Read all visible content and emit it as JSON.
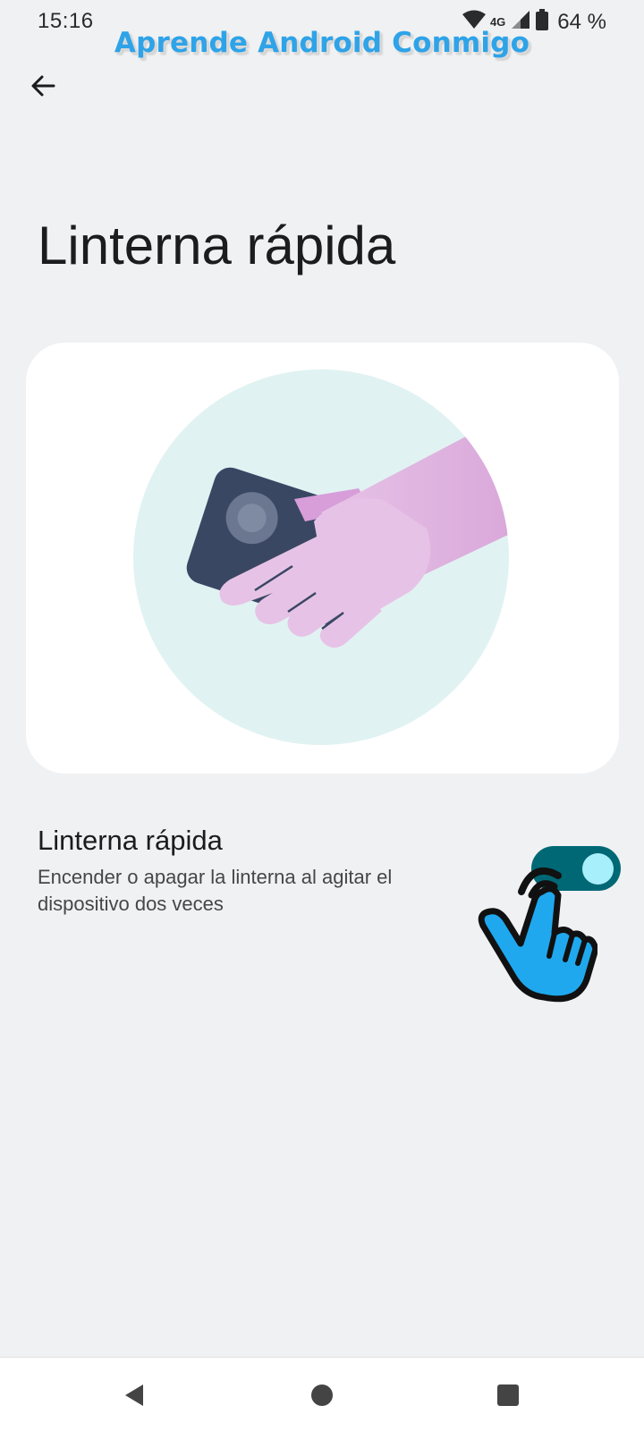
{
  "status_bar": {
    "time": "15:16",
    "network": "4G",
    "battery": "64 %",
    "icons": [
      "wifi-icon",
      "cell-signal-icon",
      "battery-icon"
    ]
  },
  "watermark": {
    "text": "Aprende Android Conmigo",
    "color": "#2ea3e8"
  },
  "header": {
    "back_icon": "arrow-left-icon"
  },
  "page": {
    "title": "Linterna rápida"
  },
  "setting": {
    "title": "Linterna rápida",
    "summary": "Encender o apagar la linterna al agitar el dispositivo dos veces",
    "toggle_on": true,
    "toggle_color": "#006875",
    "thumb_color": "#a8effc"
  },
  "nav_bar": {
    "buttons": [
      "back-triangle-icon",
      "home-circle-icon",
      "recents-square-icon"
    ]
  }
}
